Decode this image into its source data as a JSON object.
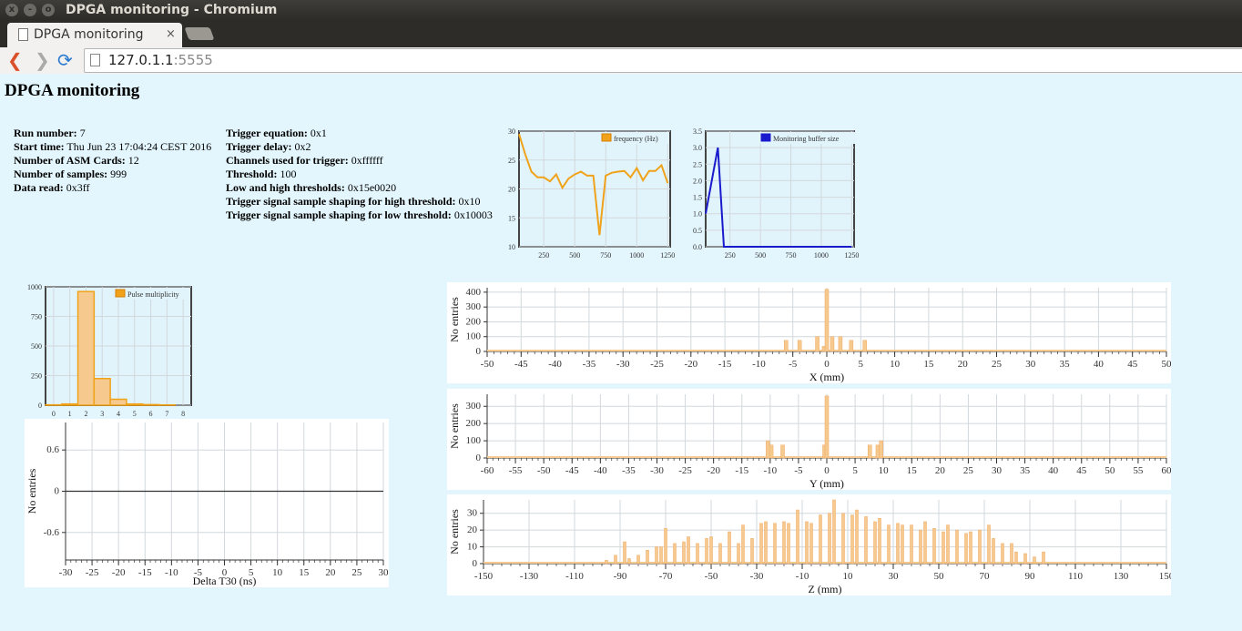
{
  "window": {
    "title": "DPGA monitoring - Chromium",
    "close": "x",
    "minimize": "-",
    "maximize": "o"
  },
  "tab": {
    "title": "DPGA monitoring",
    "close": "×"
  },
  "toolbar": {
    "back": "❮",
    "forward": "❯",
    "reload": "⟳",
    "url_host": "127.0.1.1",
    "url_port": ":5555"
  },
  "page": {
    "heading": "DPGA monitoring"
  },
  "run_info": [
    {
      "label": "Run number:",
      "value": " 7"
    },
    {
      "label": "Start time:",
      "value": " Thu Jun 23 17:04:24 CEST 2016"
    },
    {
      "label": "Number of ASM Cards:",
      "value": " 12"
    },
    {
      "label": "Number of samples:",
      "value": " 999"
    },
    {
      "label": "Data read:",
      "value": " 0x3ff"
    }
  ],
  "trigger_info": [
    {
      "label": "Trigger equation:",
      "value": " 0x1"
    },
    {
      "label": "Trigger delay:",
      "value": " 0x2"
    },
    {
      "label": "Channels used for trigger:",
      "value": " 0xffffff"
    },
    {
      "label": "Threshold:",
      "value": " 100"
    },
    {
      "label": "Low and high thresholds:",
      "value": " 0x15e0020"
    },
    {
      "label": "Trigger signal sample shaping for high threshold:",
      "value": " 0x10"
    },
    {
      "label": "Trigger signal sample shaping for low threshold:",
      "value": " 0x10003"
    }
  ],
  "colors": {
    "bg": "#e3f6fd",
    "plot_bg": "#e1f4fb",
    "orange": "#f0a21a",
    "bar_fill": "#f6c98e",
    "blue": "#1a1acd"
  },
  "chart_data": [
    {
      "id": "freq",
      "type": "line",
      "legend": "frequency (Hz)",
      "xlim": [
        50,
        1270
      ],
      "ylim": [
        10,
        30
      ],
      "xticks": [
        250,
        500,
        750,
        1000,
        1250
      ],
      "yticks": [
        10,
        15,
        20,
        25,
        30
      ],
      "x": [
        50,
        100,
        150,
        200,
        250,
        300,
        350,
        400,
        450,
        500,
        550,
        600,
        650,
        700,
        750,
        800,
        850,
        900,
        950,
        1000,
        1050,
        1100,
        1150,
        1200,
        1250
      ],
      "y": [
        29.5,
        26,
        23,
        22,
        22,
        21.3,
        22.5,
        20.2,
        21.8,
        22.5,
        23,
        22.3,
        22.3,
        12,
        22.3,
        22.8,
        23,
        23.1,
        22,
        23.6,
        21.5,
        23.1,
        23.1,
        24.1,
        21
      ]
    },
    {
      "id": "buf",
      "type": "line",
      "legend": "Monitoring buffer size",
      "xlim": [
        50,
        1270
      ],
      "ylim": [
        0,
        3.5
      ],
      "xticks": [
        250,
        500,
        750,
        1000,
        1250
      ],
      "yticks": [
        0,
        0.5,
        1.0,
        1.5,
        2.0,
        2.5,
        3.0,
        3.5
      ],
      "ytick_labels": [
        "0.0",
        "0.5",
        "1.0",
        "1.5",
        "2.0",
        "2.5",
        "3.0",
        "3.5"
      ],
      "x": [
        50,
        150,
        200,
        1250
      ],
      "y": [
        1.0,
        3.0,
        0,
        0
      ]
    },
    {
      "id": "mult",
      "type": "bar",
      "legend": "Pulse multiplicity",
      "xlim": [
        -0.5,
        8.5
      ],
      "ylim": [
        0,
        1000
      ],
      "xticks": [
        0,
        1,
        2,
        3,
        4,
        5,
        6,
        7,
        8
      ],
      "yticks": [
        0,
        250,
        500,
        750,
        1000
      ],
      "x": [
        0,
        1,
        2,
        3,
        4,
        5,
        6,
        7,
        8
      ],
      "y": [
        3,
        10,
        960,
        225,
        50,
        10,
        5,
        2,
        0
      ]
    },
    {
      "id": "dt30",
      "type": "line",
      "xlabel": "Delta T30 (ns)",
      "ylabel": "No entries",
      "xlim": [
        -30,
        30
      ],
      "ylim": [
        -1,
        1
      ],
      "xticks": [
        -30,
        -25,
        -20,
        -15,
        -10,
        -5,
        0,
        5,
        10,
        15,
        20,
        25,
        30
      ],
      "yticks": [
        -0.6,
        0,
        0.6
      ],
      "x": [
        -30,
        30
      ],
      "y": [
        0,
        0
      ]
    },
    {
      "id": "xh",
      "type": "bar",
      "xlabel": "X (mm)",
      "ylabel": "No entries",
      "xlim": [
        -50,
        50
      ],
      "ylim": [
        0,
        430
      ],
      "xticks": [
        -50,
        -45,
        -40,
        -35,
        -30,
        -25,
        -20,
        -15,
        -10,
        -5,
        0,
        5,
        10,
        15,
        20,
        25,
        30,
        35,
        40,
        45,
        50
      ],
      "yticks": [
        0,
        100,
        200,
        300,
        400
      ],
      "x": [
        -6,
        -4,
        -1.4,
        -0.4,
        0,
        0.8,
        2,
        3.6,
        5.6
      ],
      "y": [
        75,
        75,
        100,
        35,
        420,
        100,
        100,
        75,
        75
      ]
    },
    {
      "id": "yh",
      "type": "bar",
      "xlabel": "Y (mm)",
      "ylabel": "No entries",
      "xlim": [
        -60,
        60
      ],
      "ylim": [
        0,
        370
      ],
      "xticks": [
        -60,
        -55,
        -50,
        -45,
        -40,
        -35,
        -30,
        -25,
        -20,
        -15,
        -10,
        -5,
        0,
        5,
        10,
        15,
        20,
        25,
        30,
        35,
        40,
        45,
        50,
        55,
        60
      ],
      "yticks": [
        0,
        100,
        200,
        300
      ],
      "x": [
        -10.4,
        -9.8,
        -7.8,
        -0.4,
        0,
        7.6,
        9,
        9.6
      ],
      "y": [
        100,
        75,
        75,
        75,
        360,
        75,
        75,
        100
      ]
    },
    {
      "id": "zh",
      "type": "bar",
      "xlabel": "Z (mm)",
      "ylabel": "No entries",
      "xlim": [
        -150,
        150
      ],
      "ylim": [
        0,
        38
      ],
      "xticks": [
        -150,
        -130,
        -110,
        -90,
        -70,
        -50,
        -30,
        -10,
        10,
        30,
        50,
        70,
        90,
        110,
        130,
        150
      ],
      "yticks": [
        0,
        10,
        20,
        30
      ],
      "x": [
        -96,
        -92,
        -88,
        -86,
        -82,
        -78,
        -74,
        -72,
        -70,
        -66,
        -62,
        -60,
        -56,
        -52,
        -50,
        -46,
        -42,
        -38,
        -36,
        -32,
        -28,
        -26,
        -22,
        -18,
        -16,
        -12,
        -8,
        -6,
        -2,
        2,
        4,
        8,
        12,
        14,
        18,
        22,
        24,
        28,
        32,
        34,
        38,
        42,
        44,
        48,
        52,
        54,
        58,
        62,
        64,
        68,
        72,
        74,
        78,
        82,
        84,
        88,
        92,
        96
      ],
      "y": [
        2,
        5,
        13,
        3,
        5,
        8,
        10,
        10,
        21,
        12,
        13,
        16,
        12,
        15,
        16,
        12,
        19,
        12,
        23,
        15,
        24,
        25,
        24,
        25,
        24,
        32,
        25,
        24,
        29,
        30,
        38,
        30,
        29,
        32,
        28,
        25,
        27,
        23,
        24,
        23,
        23,
        20,
        25,
        21,
        19,
        23,
        20,
        18,
        19,
        20,
        23,
        15,
        12,
        12,
        7,
        6,
        4,
        7
      ]
    }
  ]
}
